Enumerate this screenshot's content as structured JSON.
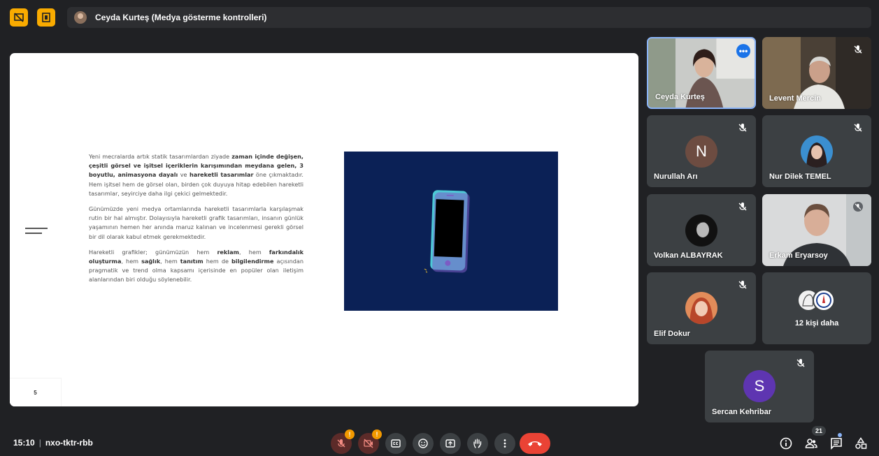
{
  "presentation_bar": {
    "title": "Ceyda Kurteş (Medya gösterme kontrolleri)"
  },
  "slide": {
    "paragraph1": [
      {
        "t": "Yeni mecralarda artık statik tasarımlardan ziyade ",
        "b": false
      },
      {
        "t": "zaman içinde değişen, çeşitli görsel ve işitsel içeriklerin karışımından meydana gelen, 3 boyutlu, animasyona dayalı",
        "b": true
      },
      {
        "t": " ve ",
        "b": false
      },
      {
        "t": "hareketli tasarımlar",
        "b": true
      },
      {
        "t": " öne çıkmaktadır. Hem işitsel hem de görsel olan, birden çok duyuya hitap edebilen hareketli tasarımlar, seyirciye daha ilgi çekici gelmektedir.",
        "b": false
      }
    ],
    "paragraph2": "Günümüzde yeni medya ortamlarında hareketli tasarımlarla karşılaşmak rutin bir hal almıştır. Dolayısıyla hareketli grafik tasarımları, insanın günlük yaşamının hemen her anında maruz kalınan ve incelenmesi gerekli görsel bir dil olarak kabul etmek gerekmektedir.",
    "paragraph3": [
      {
        "t": "Hareketli grafikler; günümüzün hem ",
        "b": false
      },
      {
        "t": "reklam",
        "b": true
      },
      {
        "t": ", hem ",
        "b": false
      },
      {
        "t": "farkındalık oluşturma",
        "b": true
      },
      {
        "t": ", hem ",
        "b": false
      },
      {
        "t": "sağlık",
        "b": true
      },
      {
        "t": ", hem ",
        "b": false
      },
      {
        "t": "tanıtım",
        "b": true
      },
      {
        "t": " hem de ",
        "b": false
      },
      {
        "t": "bilgilendirme",
        "b": true
      },
      {
        "t": " açısından pragmatik ve trend olma kapsamı içerisinde en popüler olan iletişim alanlarından biri olduğu söylenebilir.",
        "b": false
      }
    ],
    "page_number": "5"
  },
  "participants": {
    "ceyda": "Ceyda Kurteş",
    "levent": "Levent Mercin",
    "nurullah": "Nurullah Arı",
    "nurullah_initial": "N",
    "nur": "Nur Dilek TEMEL",
    "volkan": "Volkan ALBAYRAK",
    "erkam": "Erkam Eryarsoy",
    "elif": "Elif Dokur",
    "more": "12 kişi daha",
    "sercan": "Sercan Kehribar",
    "sercan_initial": "S"
  },
  "colors": {
    "nurullah_avatar": "#6d4c41",
    "sercan_avatar": "#5e35b1",
    "active_border": "#8ab4f8",
    "hangup": "#ea4335",
    "badge": "#f29900"
  },
  "meeting": {
    "time": "15:10",
    "separator": "|",
    "code": "nxo-tktr-rbb"
  },
  "controls": {
    "mic_badge": "!",
    "cam_badge": "!",
    "people_count": "21"
  }
}
